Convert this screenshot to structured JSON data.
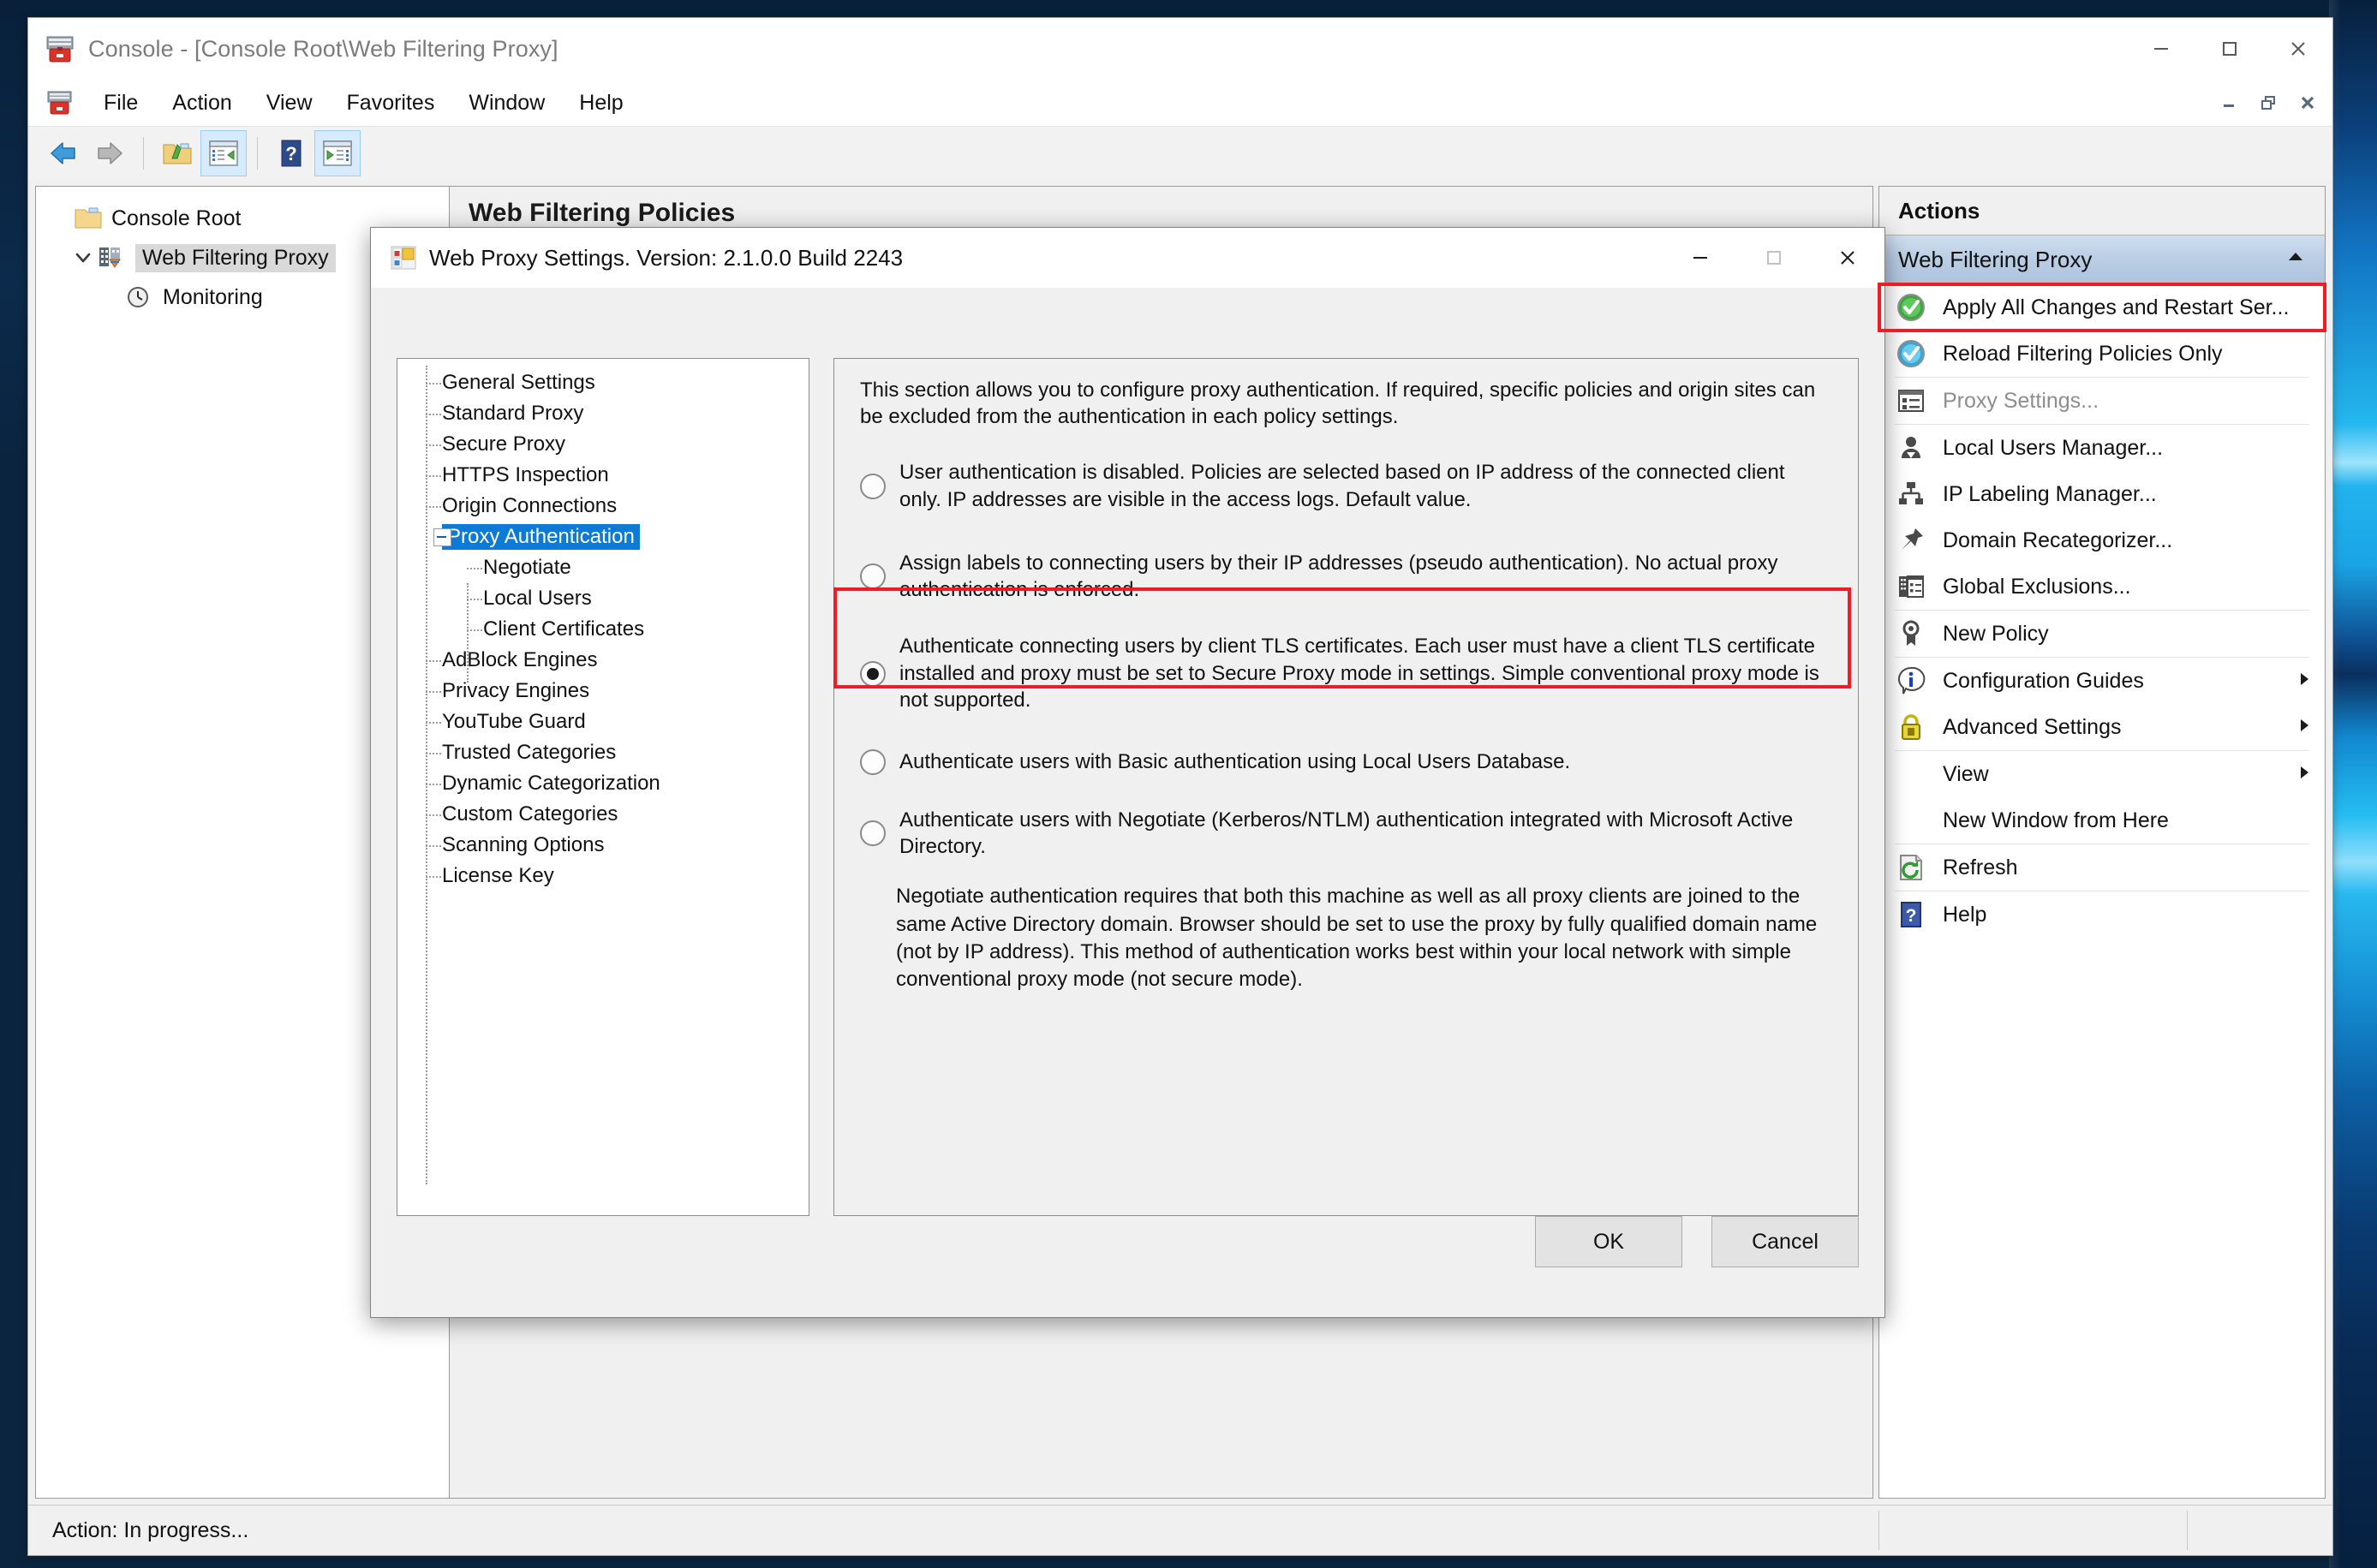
{
  "window": {
    "title": "Console - [Console Root\\Web Filtering Proxy]",
    "icon": "console-icon",
    "minimize": "minimize-icon",
    "maximize": "maximize-icon",
    "close": "close-icon"
  },
  "menubar": {
    "items": [
      "File",
      "Action",
      "View",
      "Favorites",
      "Window",
      "Help"
    ],
    "mdi": [
      "mdi-minimize-icon",
      "mdi-restore-icon",
      "mdi-close-icon"
    ]
  },
  "toolbar": {
    "buttons": [
      {
        "name": "back-icon",
        "active": false
      },
      {
        "name": "forward-icon",
        "active": false
      },
      {
        "name": "show-folder-icon",
        "active": false
      },
      {
        "name": "show-console-tree-icon",
        "active": true
      },
      {
        "name": "help-icon",
        "active": false
      },
      {
        "name": "show-action-pane-icon",
        "active": true
      }
    ]
  },
  "tree": {
    "items": [
      {
        "label": "Console Root",
        "icon": "folder-icon",
        "level": 0,
        "expander": "",
        "selected": false
      },
      {
        "label": "Web Filtering Proxy",
        "icon": "snapin-icon",
        "level": 1,
        "expander": "chevron-down-icon",
        "selected": true
      },
      {
        "label": "Monitoring",
        "icon": "clock-icon",
        "level": 2,
        "expander": "",
        "selected": false
      }
    ]
  },
  "main": {
    "header_title": "Web Filtering Policies"
  },
  "actions": {
    "header": "Actions",
    "group_label": "Web Filtering Proxy",
    "group_collapse_icon": "chevron-up-icon",
    "items": [
      {
        "label": "Apply All Changes and Restart Ser...",
        "icon": "green-check-icon",
        "disabled": false,
        "submenu": false,
        "highlighted": true,
        "sep_after": false
      },
      {
        "label": "Reload Filtering Policies Only",
        "icon": "blue-check-icon",
        "disabled": false,
        "submenu": false,
        "highlighted": false,
        "sep_after": true
      },
      {
        "label": "Proxy Settings...",
        "icon": "settings-list-icon",
        "disabled": true,
        "submenu": false,
        "highlighted": false,
        "sep_after": true
      },
      {
        "label": "Local Users Manager...",
        "icon": "user-icon",
        "disabled": false,
        "submenu": false,
        "highlighted": false,
        "sep_after": false
      },
      {
        "label": "IP Labeling Manager...",
        "icon": "org-chart-icon",
        "disabled": false,
        "submenu": false,
        "highlighted": false,
        "sep_after": false
      },
      {
        "label": "Domain Recategorizer...",
        "icon": "pin-icon",
        "disabled": false,
        "submenu": false,
        "highlighted": false,
        "sep_after": false
      },
      {
        "label": "Global Exclusions...",
        "icon": "building-list-icon",
        "disabled": false,
        "submenu": false,
        "highlighted": false,
        "sep_after": true
      },
      {
        "label": "New Policy",
        "icon": "ribbon-icon",
        "disabled": false,
        "submenu": false,
        "highlighted": false,
        "sep_after": true
      },
      {
        "label": "Configuration Guides",
        "icon": "info-icon",
        "disabled": false,
        "submenu": true,
        "highlighted": false,
        "sep_after": false
      },
      {
        "label": "Advanced Settings",
        "icon": "lock-icon",
        "disabled": false,
        "submenu": true,
        "highlighted": false,
        "sep_after": true
      },
      {
        "label": "View",
        "icon": "",
        "disabled": false,
        "submenu": true,
        "highlighted": false,
        "sep_after": false
      },
      {
        "label": "New Window from Here",
        "icon": "",
        "disabled": false,
        "submenu": false,
        "highlighted": false,
        "sep_after": true
      },
      {
        "label": "Refresh",
        "icon": "refresh-icon",
        "disabled": false,
        "submenu": false,
        "highlighted": false,
        "sep_after": true
      },
      {
        "label": "Help",
        "icon": "help-blue-icon",
        "disabled": false,
        "submenu": false,
        "highlighted": false,
        "sep_after": false
      }
    ]
  },
  "statusbar": {
    "text": "Action:  In progress..."
  },
  "dialog": {
    "title": "Web Proxy Settings. Version: 2.1.0.0 Build 2243",
    "icon": "proxy-settings-icon",
    "minimize": "minimize-icon",
    "maximize": "maximize-icon",
    "close": "close-icon",
    "tree": [
      {
        "label": "General Settings",
        "level": 1,
        "selected": false,
        "expander": false
      },
      {
        "label": "Standard Proxy",
        "level": 1,
        "selected": false,
        "expander": false
      },
      {
        "label": "Secure Proxy",
        "level": 1,
        "selected": false,
        "expander": false
      },
      {
        "label": "HTTPS Inspection",
        "level": 1,
        "selected": false,
        "expander": false
      },
      {
        "label": "Origin Connections",
        "level": 1,
        "selected": false,
        "expander": false
      },
      {
        "label": "Proxy Authentication",
        "level": 1,
        "selected": true,
        "expander": true
      },
      {
        "label": "Negotiate",
        "level": 2,
        "selected": false,
        "expander": false
      },
      {
        "label": "Local Users",
        "level": 2,
        "selected": false,
        "expander": false
      },
      {
        "label": "Client Certificates",
        "level": 2,
        "selected": false,
        "expander": false
      },
      {
        "label": "AdBlock Engines",
        "level": 1,
        "selected": false,
        "expander": false
      },
      {
        "label": "Privacy Engines",
        "level": 1,
        "selected": false,
        "expander": false
      },
      {
        "label": "YouTube Guard",
        "level": 1,
        "selected": false,
        "expander": false
      },
      {
        "label": "Trusted Categories",
        "level": 1,
        "selected": false,
        "expander": false
      },
      {
        "label": "Dynamic Categorization",
        "level": 1,
        "selected": false,
        "expander": false
      },
      {
        "label": "Custom Categories",
        "level": 1,
        "selected": false,
        "expander": false
      },
      {
        "label": "Scanning Options",
        "level": 1,
        "selected": false,
        "expander": false
      },
      {
        "label": "License Key",
        "level": 1,
        "selected": false,
        "expander": false
      }
    ],
    "panel": {
      "intro": "This section allows you to configure proxy authentication.  If required, specific policies and origin sites can be excluded from the authentication in each policy settings.",
      "options": [
        {
          "text": "User authentication is disabled. Policies are selected based on IP address of the connected client only. IP addresses are visible in the access logs. Default value.",
          "checked": false
        },
        {
          "text": "Assign labels to connecting users by their IP addresses (pseudo authentication). No actual proxy authentication is enforced.",
          "checked": false
        },
        {
          "text": "Authenticate connecting users by client TLS certificates. Each user must have a client TLS certificate installed and proxy must be set to Secure Proxy mode in settings. Simple conventional proxy mode is not supported.",
          "checked": true
        },
        {
          "text": "Authenticate users with Basic authentication using Local Users Database.",
          "checked": false
        },
        {
          "text": "Authenticate users with Negotiate (Kerberos/NTLM) authentication integrated with Microsoft Active Directory.",
          "checked": false
        }
      ],
      "note": "Negotiate authentication requires that both this machine as well as all proxy clients are joined to the same Active Directory domain. Browser should be set to use the proxy by fully qualified domain name (not by IP address). This method of authentication works best within your local network with simple conventional proxy mode (not secure mode)."
    },
    "buttons": {
      "ok": "OK",
      "cancel": "Cancel"
    }
  },
  "colors": {
    "highlight_red": "#ee1c24",
    "tree_selection_blue": "#0d7bd6",
    "accent_blue": "#1463a8"
  }
}
